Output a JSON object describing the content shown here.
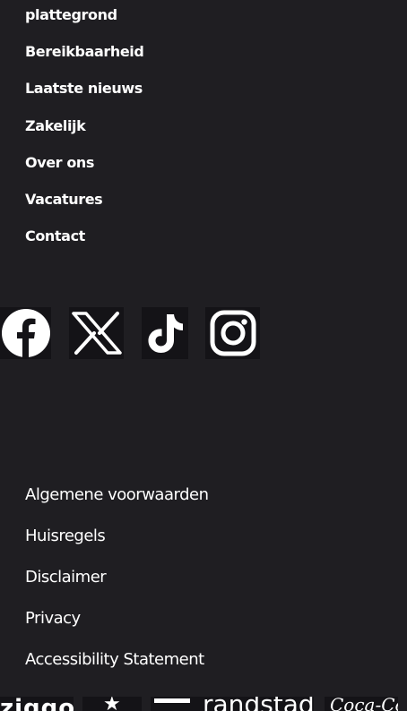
{
  "footer_nav": [
    "plattegrond",
    "Bereikbaarheid",
    "Laatste nieuws",
    "Zakelijk",
    "Over ons",
    "Vacatures",
    "Contact"
  ],
  "social": [
    {
      "name": "Facebook",
      "icon": "facebook-icon"
    },
    {
      "name": "X",
      "icon": "x-icon"
    },
    {
      "name": "TikTok",
      "icon": "tiktok-icon"
    },
    {
      "name": "Instagram",
      "icon": "instagram-icon"
    }
  ],
  "legal": [
    "Algemene voorwaarden",
    "Huisregels",
    "Disclaimer",
    "Privacy",
    "Accessibility Statement"
  ],
  "sponsors": {
    "ziggo": "ziggo",
    "randstad": "randstad",
    "cocacola": "Coca-Cola"
  },
  "colors": {
    "background": "#1f1e22",
    "tile": "#141317",
    "text": "#ffffff"
  }
}
